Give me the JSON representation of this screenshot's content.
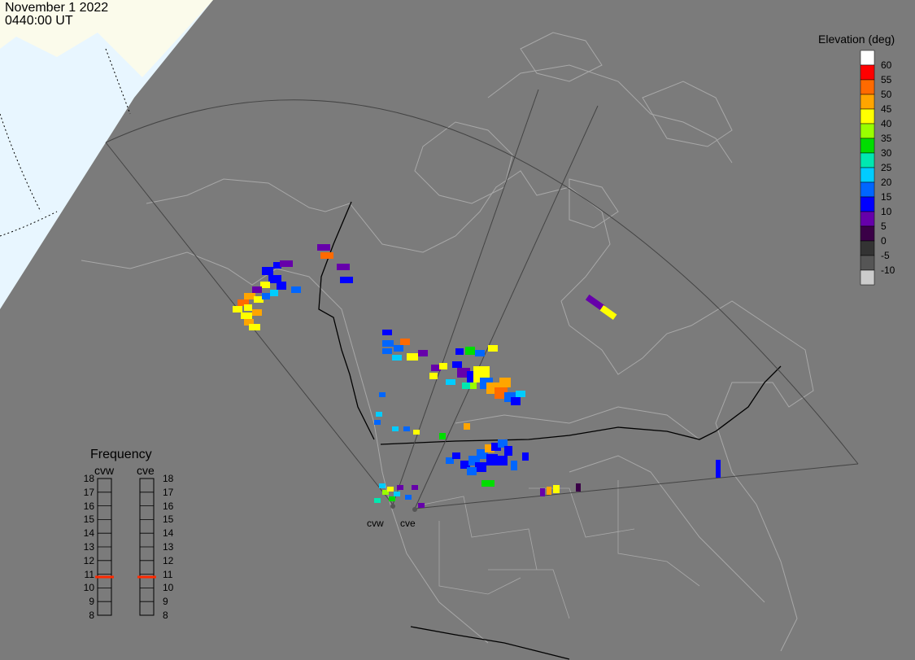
{
  "title": {
    "date": "November 1 2022",
    "time": "0440:00 UT"
  },
  "colorbar": {
    "title": "Elevation (deg)",
    "ticks": [
      "60",
      "55",
      "50",
      "45",
      "40",
      "35",
      "30",
      "25",
      "20",
      "15",
      "10",
      "5",
      "0",
      "-5",
      "-10"
    ],
    "colors": [
      "#ffffff",
      "#ff0000",
      "#ff6a00",
      "#ffa500",
      "#ffff00",
      "#99ff00",
      "#00dd00",
      "#00e8b0",
      "#00ccff",
      "#0066ff",
      "#0000ff",
      "#6600aa",
      "#3a0047",
      "#333333",
      "#555555",
      "#cccccc"
    ]
  },
  "frequency": {
    "title": "Frequency",
    "radars": [
      {
        "name": "cvw",
        "value_mhz": 10.8
      },
      {
        "name": "cve",
        "value_mhz": 10.8
      }
    ],
    "levels": [
      "18",
      "17",
      "16",
      "15",
      "14",
      "13",
      "12",
      "11",
      "10",
      "9",
      "8"
    ],
    "marker_color": "#ff2a00"
  },
  "radars": [
    {
      "name": "cvw"
    },
    {
      "name": "cve"
    }
  ],
  "colors": {
    "background": "#7b7b7b",
    "daylight": "#fbfbeb",
    "night_region": "#e8f6ff",
    "coast": "#aaaaaa",
    "fov": "#444444"
  }
}
